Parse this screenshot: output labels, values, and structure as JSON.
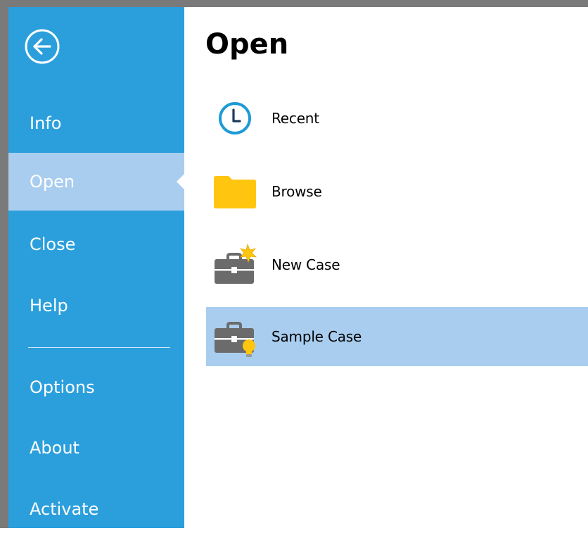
{
  "colors": {
    "sidebar_bg": "#2b9fdc",
    "selected_bg": "#a9cdef",
    "folder_yellow": "#ffc50f",
    "clock_blue": "#1e9ad6",
    "briefcase_gray": "#6b6b6b"
  },
  "sidebar": {
    "back_icon": "back-arrow-circle-icon",
    "items": [
      {
        "label": "Info"
      },
      {
        "label": "Open"
      },
      {
        "label": "Close"
      },
      {
        "label": "Help"
      },
      {
        "label": "Options"
      },
      {
        "label": "About"
      },
      {
        "label": "Activate"
      }
    ],
    "selected": "Open"
  },
  "main": {
    "title": "Open",
    "options": [
      {
        "label": "Recent",
        "icon": "clock-icon"
      },
      {
        "label": "Browse",
        "icon": "folder-icon"
      },
      {
        "label": "New Case",
        "icon": "briefcase-new-icon"
      },
      {
        "label": "Sample Case",
        "icon": "briefcase-lightbulb-icon"
      }
    ],
    "highlighted": "Sample Case"
  }
}
